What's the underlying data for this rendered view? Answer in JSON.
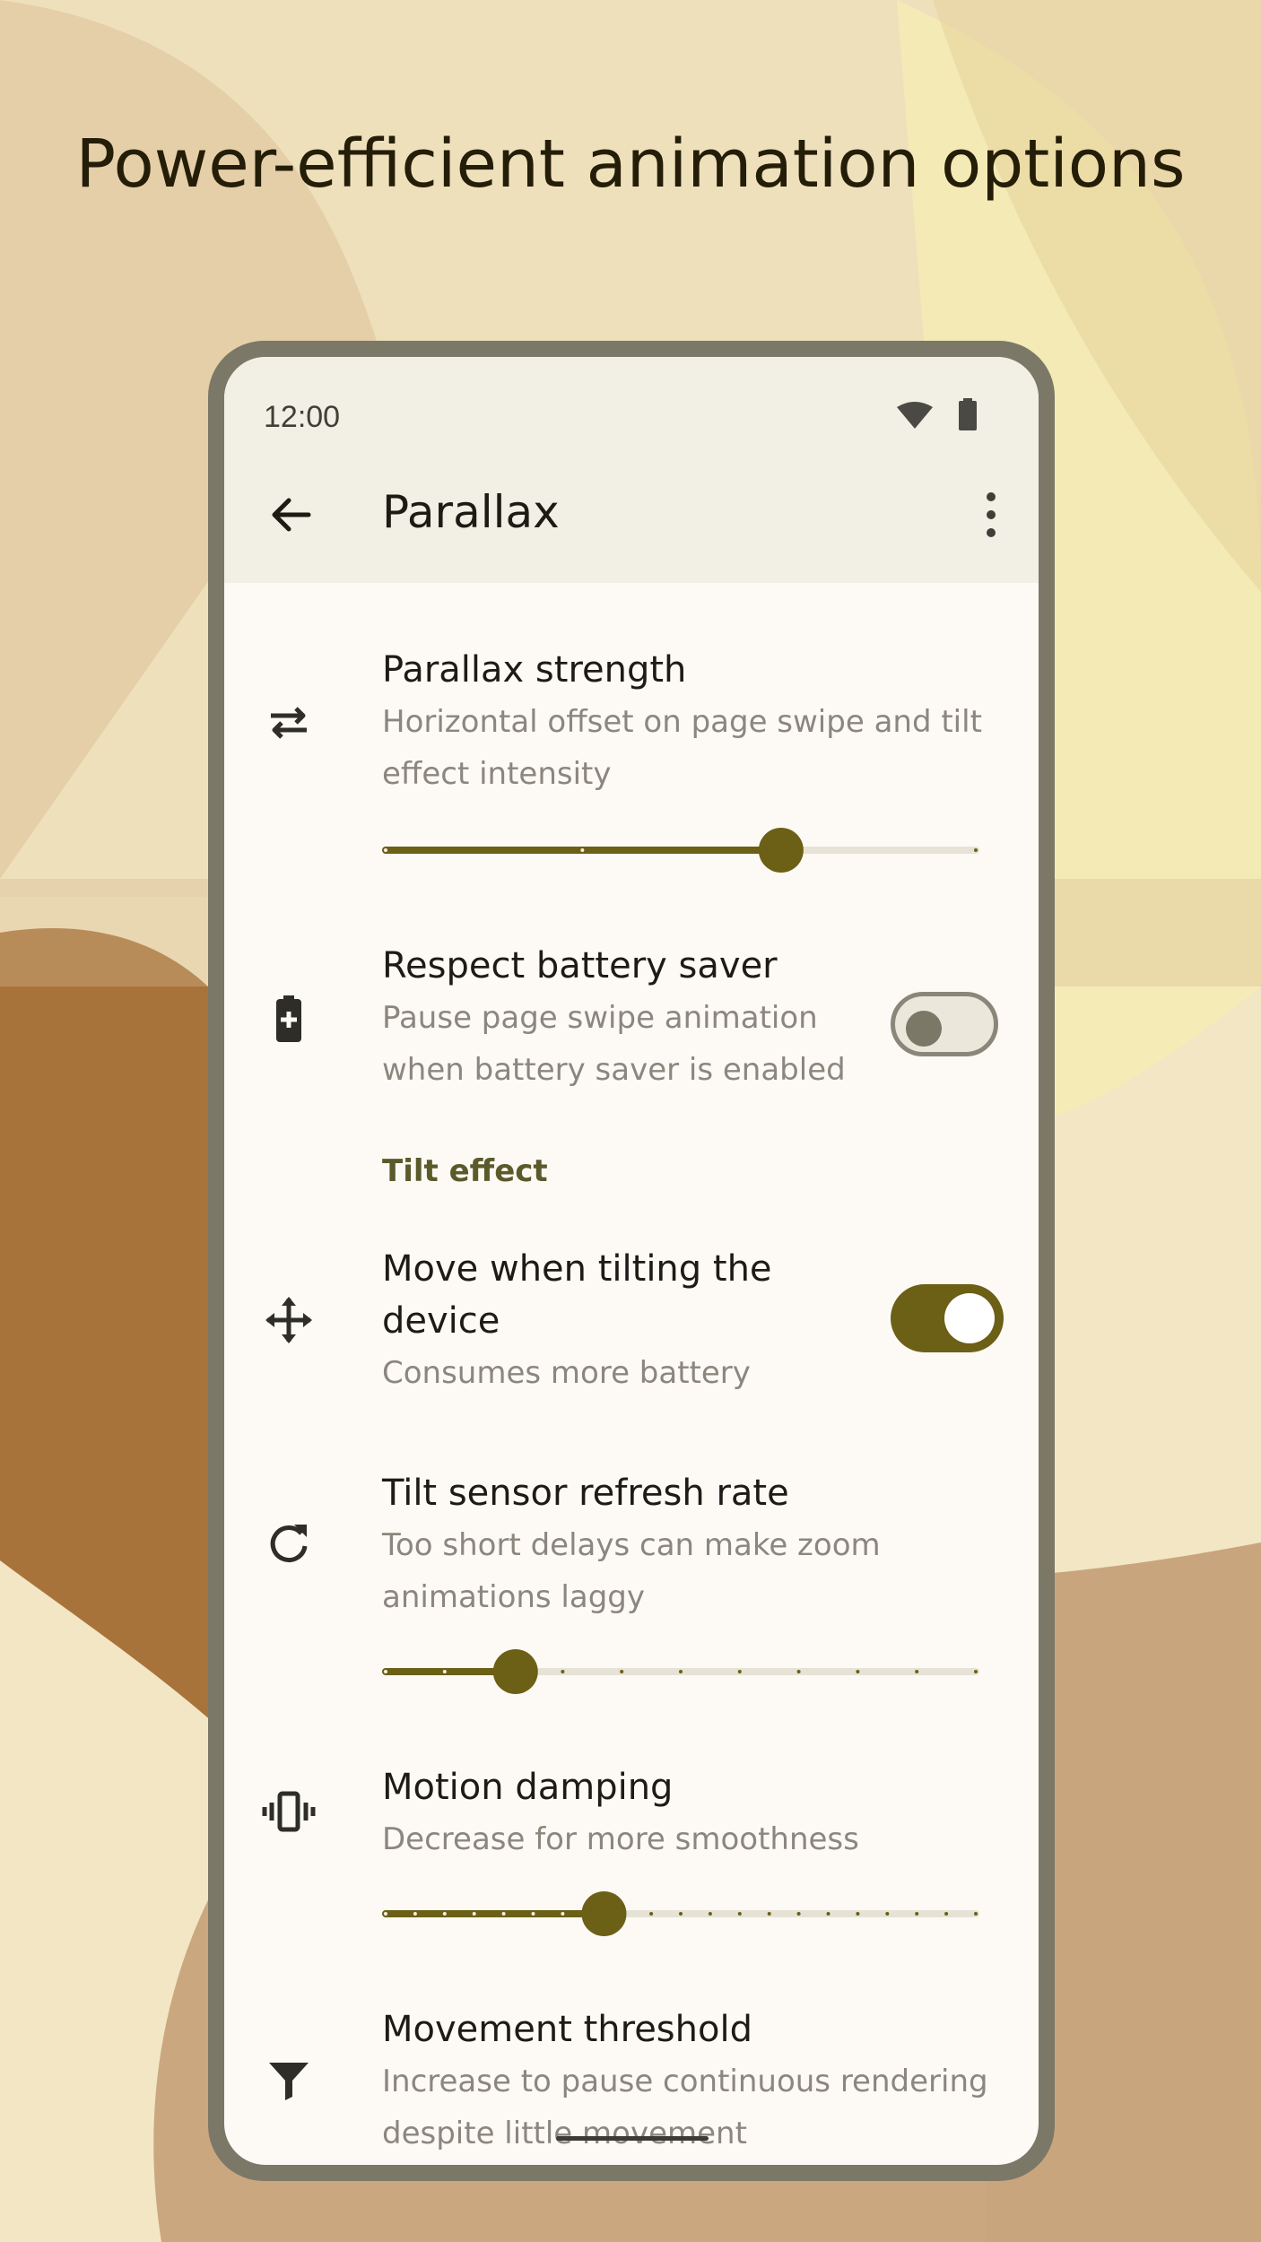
{
  "headline": "Power-efficient animation options",
  "colors": {
    "accent": "#6c5f16",
    "track": "#e6e2d6",
    "frame": "#7b7868"
  },
  "status_bar": {
    "time": "12:00",
    "icons": [
      "wifi-icon",
      "battery-icon"
    ]
  },
  "app_bar": {
    "title": "Parallax",
    "back_icon": "arrow-back-icon",
    "menu_icon": "more-vert-icon"
  },
  "settings": [
    {
      "label": "Parallax strength",
      "description": "Horizontal offset on page swipe and tilt effect intensity",
      "icon": "swap-horiz-icon",
      "control": "slider",
      "value": 0.67,
      "stops": 3
    },
    {
      "label": "Respect battery saver",
      "description": "Pause page swipe animation when battery saver is enabled",
      "icon": "battery-plus-icon",
      "control": "switch",
      "checked": false
    },
    {
      "section": "Tilt effect"
    },
    {
      "label": "Move when tilting the device",
      "description": "Consumes more battery",
      "icon": "move-arrows-icon",
      "control": "switch",
      "checked": true
    },
    {
      "label": "Tilt sensor refresh rate",
      "description": "Too short delays can make zoom animations laggy",
      "icon": "refresh-icon",
      "control": "slider",
      "value": 0.22,
      "stops": 10
    },
    {
      "label": "Motion damping",
      "description": "Decrease for more smoothness",
      "icon": "vibration-icon",
      "control": "slider",
      "value": 0.37,
      "stops": 20
    },
    {
      "label": "Movement threshold",
      "description": "Increase to pause continuous rendering despite little movement",
      "icon": "filter-icon"
    }
  ]
}
